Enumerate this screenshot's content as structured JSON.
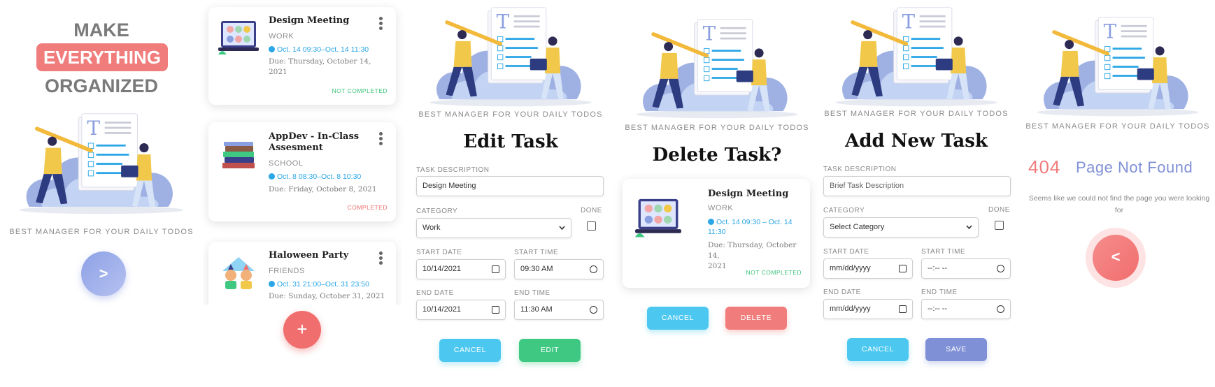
{
  "colors": {
    "accent_red": "#f07c7c",
    "accent_blue": "#4cc8f0",
    "accent_green": "#3fc882",
    "accent_purple": "#8090d6"
  },
  "welcome": {
    "line1": "MAKE",
    "line2": "EVERYTHING",
    "line3": "ORGANIZED",
    "tagline": "BEST MANAGER FOR YOUR DAILY TODOS",
    "next_label": ">"
  },
  "task_list": {
    "tasks": [
      {
        "title": "Design Meeting",
        "category": "WORK",
        "time": "Oct. 14 09:30–Oct. 14 11:30",
        "due_line1": "Due: Thursday, October 14,",
        "due_line2": "2021",
        "status": "NOT COMPLETED",
        "icon": "video-call-icon"
      },
      {
        "title_line1": "AppDev - In-Class",
        "title_line2": "Assesment",
        "category": "SCHOOL",
        "time": "Oct. 8 08:30–Oct. 8 10:30",
        "due_line1": "Due: Friday, October 8, 2021",
        "status": "COMPLETED",
        "icon": "books-icon"
      },
      {
        "title": "Haloween Party",
        "category": "FRIENDS",
        "time": "Oct. 31 21:00–Oct. 31 23:50",
        "due_line1": "Due: Sunday, October 31, 2021",
        "icon": "party-people-icon"
      }
    ],
    "add_label": "+"
  },
  "edit_task": {
    "tagline": "BEST MANAGER FOR YOUR DAILY TODOS",
    "heading": "Edit Task",
    "desc_label": "TASK DESCRIPTION",
    "desc_value": "Design Meeting",
    "category_label": "CATEGORY",
    "category_value": "Work",
    "done_label": "DONE",
    "start_date_label": "START DATE",
    "start_date_value": "10/14/2021",
    "start_time_label": "START TIME",
    "start_time_value": "09:30 AM",
    "end_date_label": "END DATE",
    "end_date_value": "10/14/2021",
    "end_time_label": "END TIME",
    "end_time_value": "11:30 AM",
    "cancel_label": "CANCEL",
    "edit_label": "EDIT"
  },
  "delete_task": {
    "tagline": "BEST MANAGER FOR YOUR DAILY TODOS",
    "heading": "Delete Task?",
    "card": {
      "title": "Design Meeting",
      "category": "WORK",
      "time_line1": "Oct. 14 09:30 – Oct. 14",
      "time_line2": "11:30",
      "due_line1": "Due: Thursday, October 14,",
      "due_line2": "2021",
      "status": "NOT COMPLETED"
    },
    "cancel_label": "CANCEL",
    "delete_label": "DELETE"
  },
  "add_task": {
    "tagline": "BEST MANAGER FOR YOUR DAILY TODOS",
    "heading": "Add New Task",
    "desc_label": "TASK DESCRIPTION",
    "desc_placeholder": "Brief Task Description",
    "category_label": "CATEGORY",
    "category_placeholder": "Select Category",
    "done_label": "DONE",
    "start_date_label": "START DATE",
    "start_date_placeholder": "mm/dd/yyyy",
    "start_time_label": "START TIME",
    "start_time_placeholder": "--:-- --",
    "end_date_label": "END DATE",
    "end_date_placeholder": "mm/dd/yyyy",
    "end_time_label": "END TIME",
    "end_time_placeholder": "--:-- --",
    "cancel_label": "CANCEL",
    "save_label": "SAVE"
  },
  "not_found": {
    "tagline": "BEST MANAGER FOR YOUR DAILY TODOS",
    "code": "404",
    "title": "Page Not Found",
    "message": "Seems like we could not find the page you were looking for",
    "back_label": "<"
  }
}
